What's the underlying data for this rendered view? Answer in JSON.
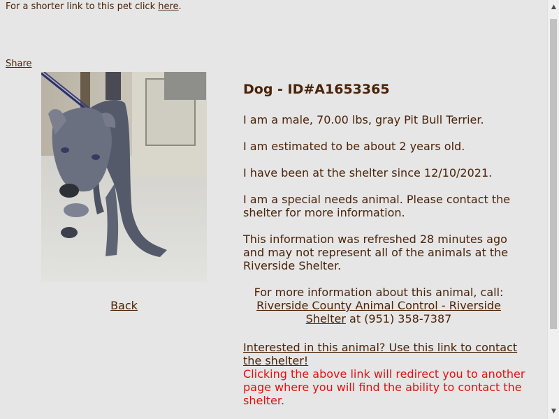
{
  "header": {
    "shorter_link_prefix": "For a shorter link to this pet click ",
    "here_link": "here",
    "shorter_link_suffix": ".",
    "share_link": "Share"
  },
  "photo": {
    "subject": "gray pit bull terrier dog photo"
  },
  "back_link": "Back",
  "info": {
    "title": "Dog - ID#A1653365",
    "description": "I am a male, 70.00 lbs, gray Pit Bull Terrier.",
    "age": "I am estimated to be about 2 years old.",
    "since": "I have been at the shelter since 12/10/2021.",
    "special_needs": "I am a special needs animal. Please contact the shelter for more information.",
    "refresh_note": "This information was refreshed 28 minutes ago and may not represent all of the animals at the Riverside Shelter.",
    "contact_intro": "For more information about this animal, call:",
    "shelter_link": "Riverside County Animal Control - Riverside Shelter",
    "phone": " at (951) 358-7387",
    "interest_link": "Interested in this animal? Use this link to contact the shelter!",
    "redirect_warning": "Clicking the above link will redirect you to another page where you will find the ability to contact the shelter."
  },
  "scrollbar": {
    "up_icon": "triangle-up",
    "down_icon": "triangle-down"
  },
  "colors": {
    "background": "#e6e6e6",
    "text": "#4a2308",
    "warning": "#e01010"
  }
}
